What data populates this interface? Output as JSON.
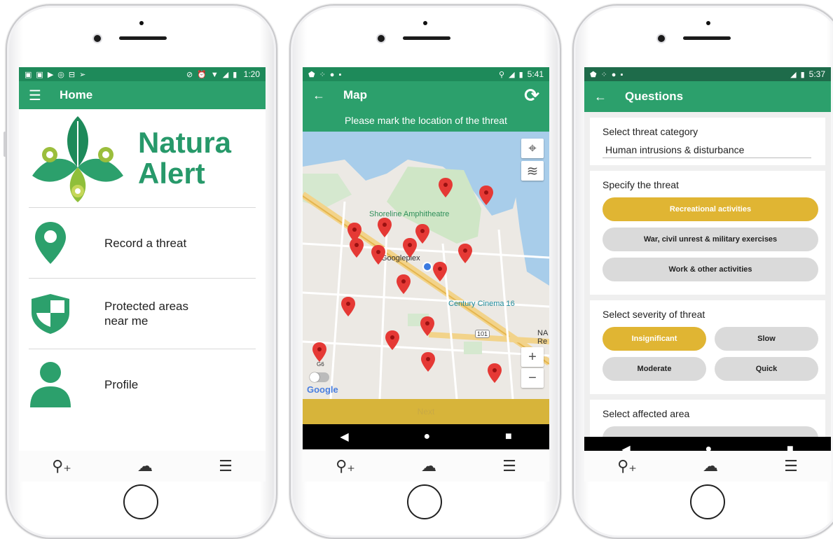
{
  "phone1": {
    "status": {
      "time": "1:20"
    },
    "appbar": {
      "title": "Home"
    },
    "logo": {
      "line1": "Natura",
      "line2": "Alert"
    },
    "menu": [
      {
        "label": "Record a threat",
        "icon": "location-pin-icon"
      },
      {
        "label": "Protected areas near me",
        "icon": "shield-icon"
      },
      {
        "label": "Profile",
        "icon": "person-icon"
      }
    ]
  },
  "phone2": {
    "status": {
      "time": "5:41"
    },
    "appbar": {
      "title": "Map"
    },
    "banner": "Please mark the location of the threat",
    "map_labels": {
      "amphitheatre": "Shoreline Amphitheatre",
      "googleplex": "Googleplex",
      "cinema": "Century Cinema 16",
      "na": "NA",
      "re": "Re",
      "route": "101",
      "g6": "G6",
      "google": "Google"
    },
    "next_label": "Next"
  },
  "phone3": {
    "status": {
      "time": "5:37"
    },
    "appbar": {
      "title": "Questions"
    },
    "category": {
      "heading": "Select threat category",
      "value": "Human intrusions & disturbance"
    },
    "threat": {
      "heading": "Specify the threat",
      "options": [
        "Recreational activities",
        "War, civil unrest & military exercises",
        "Work & other activities"
      ],
      "selected": "Recreational activities"
    },
    "severity": {
      "heading": "Select severity of threat",
      "options": [
        "Insignificant",
        "Slow",
        "Moderate",
        "Quick"
      ],
      "selected": "Insignificant"
    },
    "area": {
      "heading": "Select affected area"
    }
  },
  "colors": {
    "primary": "#2ca06c",
    "status": "#1e8a5a",
    "accent": "#e0b533"
  }
}
